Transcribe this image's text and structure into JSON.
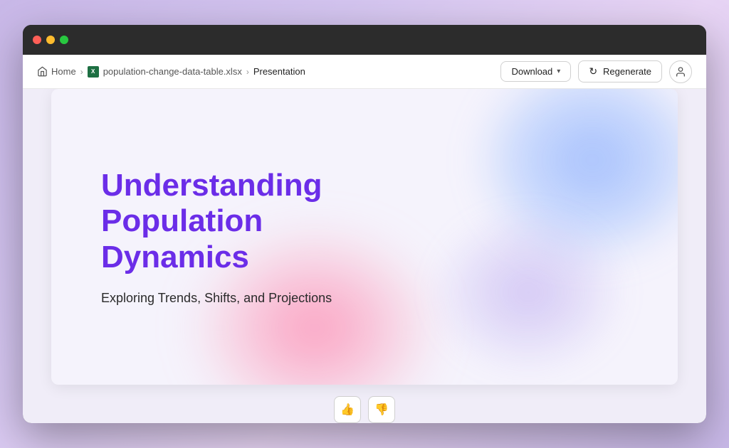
{
  "window": {
    "traffic_lights": [
      "red",
      "yellow",
      "green"
    ]
  },
  "nav": {
    "breadcrumb": {
      "home_label": "Home",
      "file_label": "population-change-data-table.xlsx",
      "current_label": "Presentation"
    },
    "download_label": "Download",
    "regenerate_label": "Regenerate",
    "user_icon": "👤"
  },
  "slide": {
    "title": "Understanding Population Dynamics",
    "subtitle": "Exploring Trends, Shifts, and Projections"
  },
  "feedback": {
    "thumbs_up": "👍",
    "thumbs_down": "👎"
  }
}
